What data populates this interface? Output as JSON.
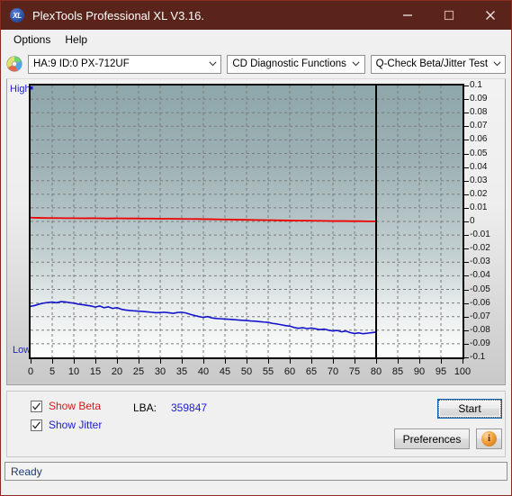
{
  "window": {
    "title": "PlexTools Professional XL V3.16.",
    "icon": "xl-app-icon",
    "minimize_label": "Minimize",
    "maximize_label": "Maximize",
    "close_label": "Close",
    "titlebar_color": "#5b241a"
  },
  "menu": {
    "items": [
      {
        "label": "Options"
      },
      {
        "label": "Help"
      }
    ]
  },
  "toolbar": {
    "disc_icon": "cd-disc-icon",
    "drive_select": {
      "value": "HA:9 ID:0  PX-712UF"
    },
    "function_select": {
      "value": "CD Diagnostic Functions"
    },
    "test_select": {
      "value": "Q-Check Beta/Jitter Test"
    }
  },
  "chart_data": {
    "type": "line",
    "title": "",
    "xlabel": "",
    "ylabel": "",
    "xlim": [
      0,
      100
    ],
    "ylim": [
      -0.1,
      0.1
    ],
    "xticks": [
      0,
      5,
      10,
      15,
      20,
      25,
      30,
      35,
      40,
      45,
      50,
      55,
      60,
      65,
      70,
      75,
      80,
      85,
      90,
      95,
      100
    ],
    "yticks": [
      0.1,
      0.09,
      0.08,
      0.07,
      0.06,
      0.05,
      0.04,
      0.03,
      0.02,
      0.01,
      0,
      -0.01,
      -0.02,
      -0.03,
      -0.04,
      -0.05,
      -0.06,
      -0.07,
      -0.08,
      -0.09,
      -0.1
    ],
    "grid": true,
    "left_axis_labels": {
      "top": "High",
      "bottom": "Low"
    },
    "progress_marker_x": 80,
    "series": [
      {
        "name": "Beta",
        "color": "#ee0000",
        "x": [
          0,
          2,
          4,
          6,
          8,
          10,
          12,
          14,
          16,
          18,
          20,
          22,
          24,
          26,
          28,
          30,
          32,
          34,
          36,
          38,
          40,
          42,
          44,
          46,
          48,
          50,
          52,
          54,
          56,
          58,
          60,
          62,
          64,
          66,
          68,
          70,
          72,
          74,
          76,
          78,
          80
        ],
        "values": [
          0.0028,
          0.0026,
          0.0025,
          0.0025,
          0.0024,
          0.0024,
          0.0023,
          0.0024,
          0.0023,
          0.0022,
          0.0023,
          0.0022,
          0.0022,
          0.0021,
          0.0021,
          0.002,
          0.002,
          0.0019,
          0.0018,
          0.0018,
          0.0017,
          0.0016,
          0.0015,
          0.0014,
          0.0013,
          0.0012,
          0.0011,
          0.001,
          0.0009,
          0.0008,
          0.0007,
          0.0006,
          0.0006,
          0.0005,
          0.0004,
          0.0003,
          0.0003,
          0.0002,
          0.0002,
          0.0001,
          0.0001
        ]
      },
      {
        "name": "Jitter",
        "color": "#1414cc",
        "x": [
          0,
          1,
          2,
          3,
          4,
          5,
          6,
          7,
          8,
          9,
          10,
          11,
          12,
          13,
          14,
          15,
          16,
          17,
          18,
          19,
          20,
          21,
          22,
          23,
          24,
          25,
          26,
          27,
          28,
          29,
          30,
          31,
          32,
          33,
          34,
          35,
          36,
          37,
          38,
          39,
          40,
          41,
          42,
          43,
          44,
          45,
          46,
          47,
          48,
          49,
          50,
          51,
          52,
          53,
          54,
          55,
          56,
          57,
          58,
          59,
          60,
          61,
          62,
          63,
          64,
          65,
          66,
          67,
          68,
          69,
          70,
          71,
          72,
          73,
          74,
          75,
          76,
          77,
          78,
          79,
          80
        ],
        "values": [
          -0.0625,
          -0.0618,
          -0.0608,
          -0.0601,
          -0.0596,
          -0.0593,
          -0.0598,
          -0.059,
          -0.0592,
          -0.0597,
          -0.0601,
          -0.0608,
          -0.0612,
          -0.0617,
          -0.0622,
          -0.063,
          -0.0622,
          -0.0635,
          -0.0628,
          -0.064,
          -0.0634,
          -0.0646,
          -0.0652,
          -0.0655,
          -0.0658,
          -0.066,
          -0.0662,
          -0.0665,
          -0.0668,
          -0.0672,
          -0.067,
          -0.0668,
          -0.0672,
          -0.0676,
          -0.067,
          -0.0668,
          -0.0674,
          -0.0684,
          -0.0692,
          -0.07,
          -0.0706,
          -0.07,
          -0.071,
          -0.0714,
          -0.0716,
          -0.0718,
          -0.072,
          -0.0722,
          -0.0725,
          -0.0727,
          -0.0729,
          -0.0732,
          -0.0734,
          -0.0737,
          -0.074,
          -0.0742,
          -0.075,
          -0.0754,
          -0.076,
          -0.0766,
          -0.077,
          -0.078,
          -0.0786,
          -0.0782,
          -0.0788,
          -0.0784,
          -0.079,
          -0.0796,
          -0.0792,
          -0.08,
          -0.0806,
          -0.0802,
          -0.0812,
          -0.0806,
          -0.0818,
          -0.0824,
          -0.082,
          -0.0826,
          -0.0822,
          -0.0818,
          -0.0814
        ]
      }
    ]
  },
  "controls": {
    "show_beta": {
      "label": "Show Beta",
      "checked": true,
      "color": "#d21b1b"
    },
    "show_jitter": {
      "label": "Show Jitter",
      "checked": true,
      "color": "#1b1bd2"
    },
    "lba_label": "LBA:",
    "lba_value": "359847",
    "start_button": "Start",
    "preferences_button": "Preferences",
    "info_button": "i"
  },
  "status": {
    "text": "Ready"
  }
}
